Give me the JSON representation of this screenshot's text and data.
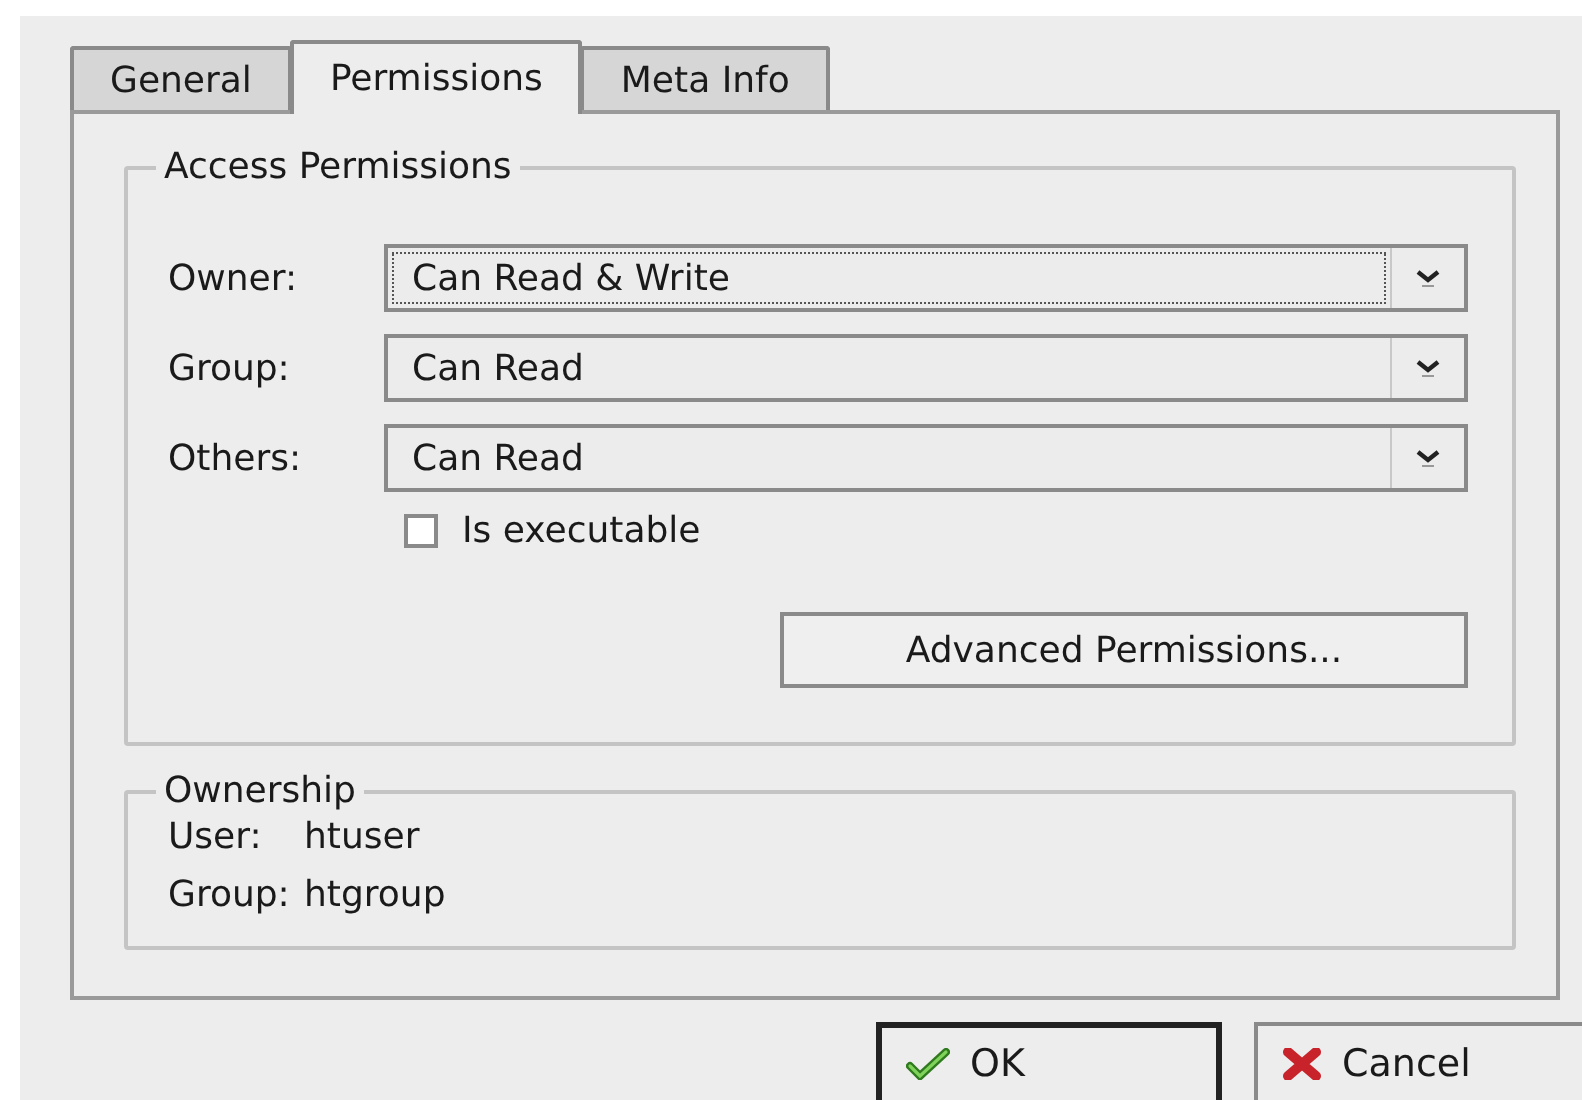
{
  "tabs": [
    {
      "label": "General",
      "selected": false
    },
    {
      "label": "Permissions",
      "selected": true
    },
    {
      "label": "Meta Info",
      "selected": false
    }
  ],
  "access_permissions": {
    "title": "Access Permissions",
    "fields": [
      {
        "label": "Owner:",
        "value": "Can Read & Write",
        "focused": true
      },
      {
        "label": "Group:",
        "value": "Can Read",
        "focused": false
      },
      {
        "label": "Others:",
        "value": "Can Read",
        "focused": false
      }
    ],
    "executable": {
      "label": "Is executable",
      "checked": false
    },
    "advanced_button": "Advanced Permissions..."
  },
  "ownership": {
    "title": "Ownership",
    "rows": [
      {
        "label": "User:",
        "value": "htuser"
      },
      {
        "label": "Group:",
        "value": "htgroup"
      }
    ]
  },
  "buttons": [
    {
      "kind": "ok",
      "label": "OK",
      "default": true
    },
    {
      "kind": "cancel",
      "label": "Cancel",
      "default": false
    }
  ]
}
